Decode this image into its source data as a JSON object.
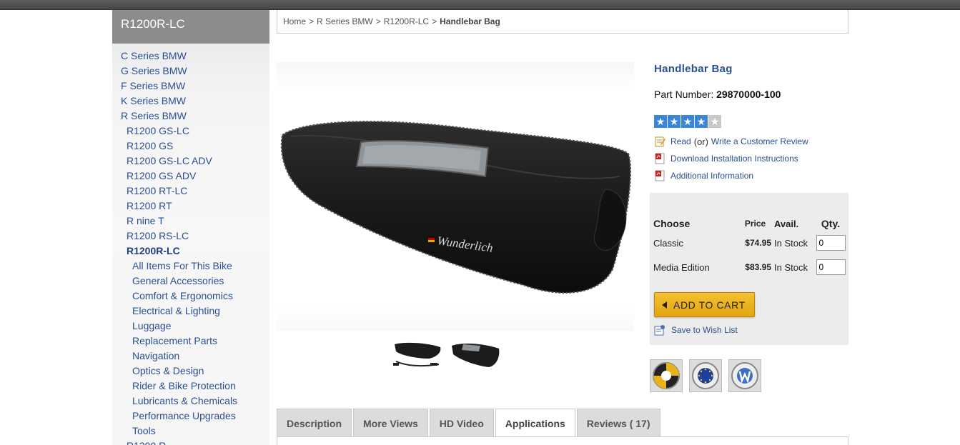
{
  "sidebar": {
    "title": "R1200R-LC",
    "items": [
      {
        "label": "C Series BMW",
        "level": 0
      },
      {
        "label": "G Series BMW",
        "level": 0
      },
      {
        "label": "F Series BMW",
        "level": 0
      },
      {
        "label": "K Series BMW",
        "level": 0
      },
      {
        "label": "R Series BMW",
        "level": 0
      },
      {
        "label": "R1200 GS-LC",
        "level": 1
      },
      {
        "label": "R1200 GS",
        "level": 1
      },
      {
        "label": "R1200 GS-LC ADV",
        "level": 1
      },
      {
        "label": "R1200 GS ADV",
        "level": 1
      },
      {
        "label": "R1200 RT-LC",
        "level": 1
      },
      {
        "label": "R1200 RT",
        "level": 1
      },
      {
        "label": "R nine T",
        "level": 1
      },
      {
        "label": "R1200 RS-LC",
        "level": 1
      },
      {
        "label": "R1200R-LC",
        "level": 1,
        "active": true
      },
      {
        "label": "All Items For This Bike",
        "level": 2
      },
      {
        "label": "General Accessories",
        "level": 2
      },
      {
        "label": "Comfort & Ergonomics",
        "level": 2
      },
      {
        "label": "Electrical & Lighting",
        "level": 2
      },
      {
        "label": "Luggage",
        "level": 2
      },
      {
        "label": "Replacement Parts",
        "level": 2
      },
      {
        "label": "Navigation",
        "level": 2
      },
      {
        "label": "Optics & Design",
        "level": 2
      },
      {
        "label": "Rider & Bike Protection",
        "level": 2
      },
      {
        "label": "Lubricants & Chemicals",
        "level": 2
      },
      {
        "label": "Performance Upgrades",
        "level": 2
      },
      {
        "label": "Tools",
        "level": 2
      },
      {
        "label": "R1200 R",
        "level": 1
      }
    ]
  },
  "breadcrumb": {
    "items": [
      "Home",
      "R Series BMW",
      "R1200R-LC"
    ],
    "separator": ">",
    "current": "Handlebar Bag"
  },
  "product": {
    "title": "Handlebar Bag",
    "part_label": "Part Number:",
    "part_number": "29870000-100",
    "rating": 4,
    "rating_max": 5,
    "brand_on_bag": "Wunderlich",
    "links": {
      "read": "Read",
      "or": "(or)",
      "write_review": "Write a Customer Review",
      "download": "Download Installation Instructions",
      "additional": "Additional Information"
    }
  },
  "purchase": {
    "headers": {
      "choose": "Choose",
      "price": "Price",
      "avail": "Avail.",
      "qty": "Qty."
    },
    "rows": [
      {
        "name": "Classic",
        "price": "$74.95",
        "avail": "In Stock",
        "qty": "0"
      },
      {
        "name": "Media Edition",
        "price": "$83.95",
        "avail": "In Stock",
        "qty": "0"
      }
    ],
    "add_to_cart": "ADD TO CART",
    "wishlist": "Save to Wish List"
  },
  "badges": [
    {
      "name": "cordura-badge",
      "text": "CORDURA"
    },
    {
      "name": "made-in-europe-badge",
      "text": "MADE IN EUROPE"
    },
    {
      "name": "made-by-wunderlich-badge",
      "text": "W"
    }
  ],
  "tabs": [
    {
      "label": "Description",
      "active": false
    },
    {
      "label": "More Views",
      "active": false
    },
    {
      "label": "HD Video",
      "active": false
    },
    {
      "label": "Applications",
      "active": true
    },
    {
      "label": "Reviews ( 17)",
      "active": false
    }
  ],
  "colors": {
    "link": "#2a4f92",
    "star": "#3b86d8",
    "cart": "#e9b020",
    "sidebar_head": "#8c8c8c"
  }
}
